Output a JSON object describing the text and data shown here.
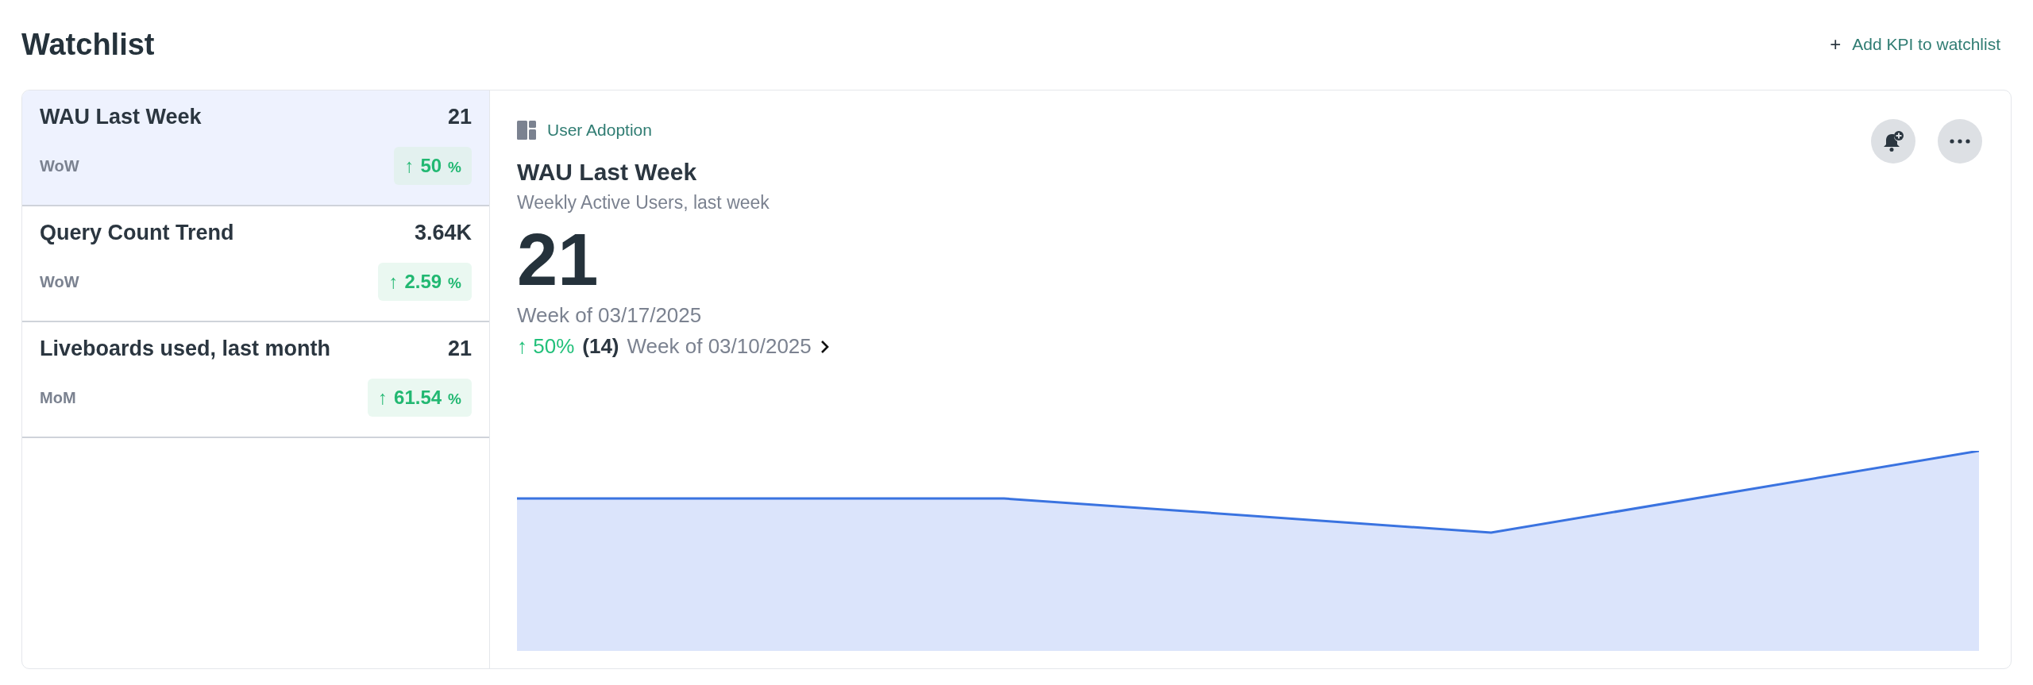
{
  "page": {
    "title": "Watchlist",
    "add_action": {
      "icon": "+",
      "label": "Add KPI to watchlist"
    }
  },
  "kpis": [
    {
      "name": "WAU Last Week",
      "value": "21",
      "period": "WoW",
      "arrow": "↑",
      "change": "50",
      "unit": "%",
      "selected": true
    },
    {
      "name": "Query Count Trend",
      "value": "3.64K",
      "period": "WoW",
      "arrow": "↑",
      "change": "2.59",
      "unit": "%",
      "selected": false
    },
    {
      "name": "Liveboards used, last month",
      "value": "21",
      "period": "MoM",
      "arrow": "↑",
      "change": "61.54",
      "unit": "%",
      "selected": false
    }
  ],
  "detail": {
    "source": "User Adoption",
    "title": "WAU Last Week",
    "description": "Weekly Active Users, last week",
    "value": "21",
    "period": "Week of 03/17/2025",
    "comparison": {
      "arrow": "↑",
      "change": "50%",
      "previous_value": "(14)",
      "previous_period": "Week of 03/10/2025"
    }
  }
}
